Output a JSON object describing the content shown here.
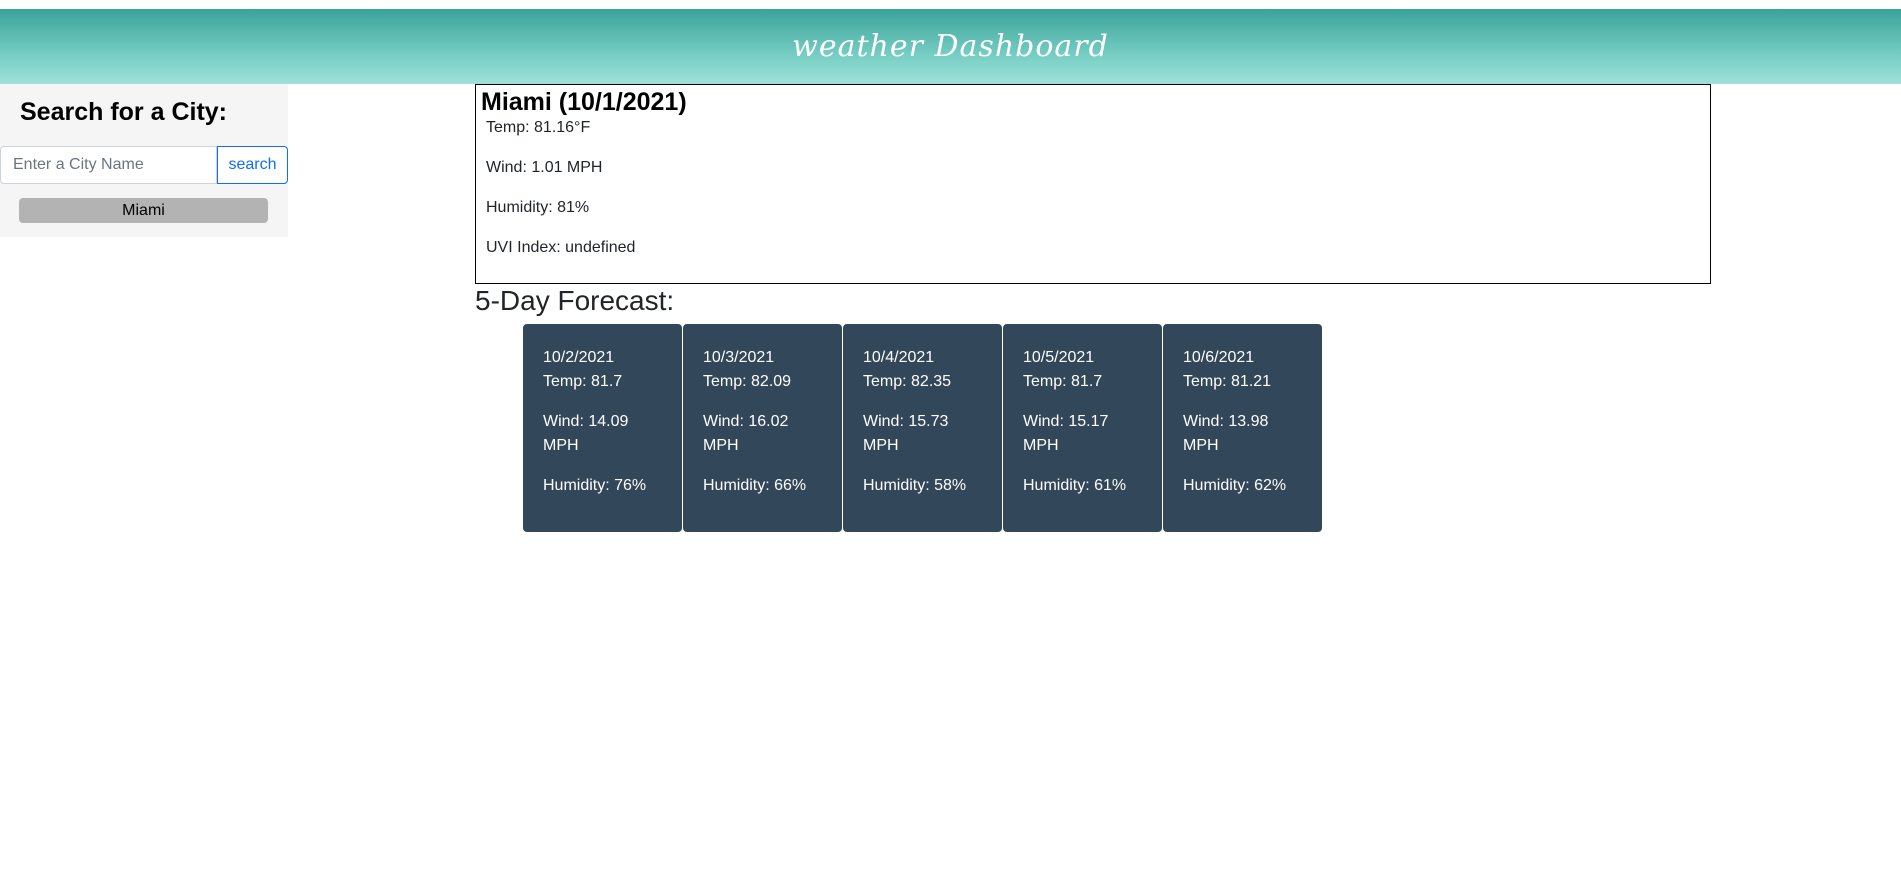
{
  "header": {
    "title": "weather Dashboard"
  },
  "sidebar": {
    "heading": "Search for a City:",
    "search_placeholder": "Enter a City Name",
    "search_value": "",
    "search_button_label": "search",
    "history": [
      "Miami"
    ]
  },
  "current": {
    "title": "Miami (10/1/2021)",
    "temp": "Temp: 81.16°F",
    "wind": "Wind: 1.01 MPH",
    "humidity": "Humidity: 81%",
    "uvi": "UVI Index: undefined"
  },
  "forecast": {
    "heading": "5-Day Forecast:",
    "days": [
      {
        "date": "10/2/2021",
        "temp": "Temp: 81.7",
        "wind": "Wind: 14.09 MPH",
        "humidity": "Humidity: 76%"
      },
      {
        "date": "10/3/2021",
        "temp": "Temp: 82.09",
        "wind": "Wind: 16.02 MPH",
        "humidity": "Humidity: 66%"
      },
      {
        "date": "10/4/2021",
        "temp": "Temp: 82.35",
        "wind": "Wind: 15.73 MPH",
        "humidity": "Humidity: 58%"
      },
      {
        "date": "10/5/2021",
        "temp": "Temp: 81.7",
        "wind": "Wind: 15.17 MPH",
        "humidity": "Humidity: 61%"
      },
      {
        "date": "10/6/2021",
        "temp": "Temp: 81.21",
        "wind": "Wind: 13.98 MPH",
        "humidity": "Humidity: 62%"
      }
    ]
  },
  "colors": {
    "header_gradient_top": "#3aa39a",
    "header_gradient_bottom": "#9fe0d8",
    "sidebar_bg": "#f5f5f5",
    "search_button": "#0d6efd",
    "history_button_bg": "#b3b3b3",
    "forecast_card_bg": "#33475b"
  }
}
